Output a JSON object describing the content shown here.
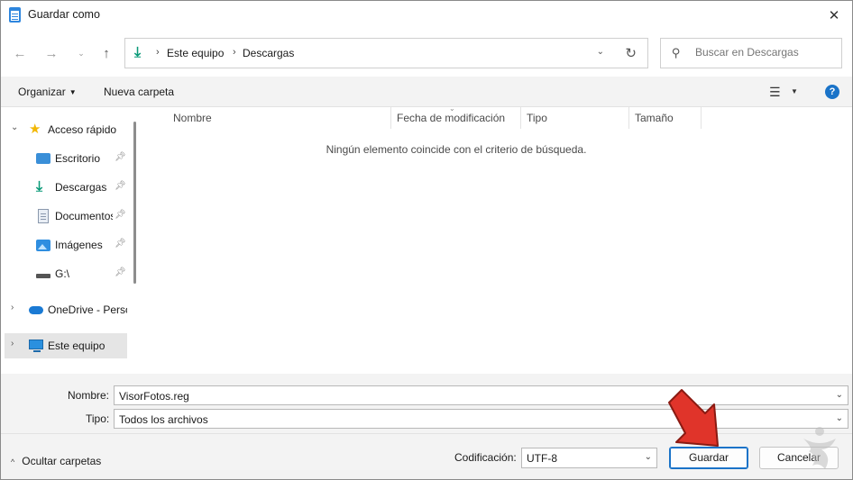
{
  "window": {
    "title": "Guardar como"
  },
  "address": {
    "crumbs": [
      "Este equipo",
      "Descargas"
    ],
    "separator": "›"
  },
  "search": {
    "placeholder": "Buscar en Descargas"
  },
  "toolbar": {
    "organize_label": "Organizar",
    "new_folder_label": "Nueva carpeta",
    "help_label": "?"
  },
  "navpane": {
    "items": [
      {
        "label": "Acceso rápido",
        "icon": "star-icon"
      },
      {
        "label": "Escritorio",
        "icon": "desktop-icon",
        "pinned": true
      },
      {
        "label": "Descargas",
        "icon": "download-icon",
        "pinned": true
      },
      {
        "label": "Documentos",
        "icon": "document-icon",
        "pinned": true
      },
      {
        "label": "Imágenes",
        "icon": "pictures-icon",
        "pinned": true
      },
      {
        "label": "G:\\",
        "icon": "drive-icon",
        "pinned": true
      },
      {
        "label": "OneDrive - Personal",
        "icon": "onedrive-icon"
      },
      {
        "label": "Este equipo",
        "icon": "computer-icon",
        "selected": true
      }
    ]
  },
  "content": {
    "columns": [
      "Nombre",
      "Fecha de modificación",
      "Tipo",
      "Tamaño"
    ],
    "empty_message": "Ningún elemento coincide con el criterio de búsqueda."
  },
  "form": {
    "name_label": "Nombre:",
    "name_value": "VisorFotos.reg",
    "type_label": "Tipo:",
    "type_value": "Todos los archivos"
  },
  "footer": {
    "hide_folders_label": "Ocultar carpetas",
    "encoding_label": "Codificación:",
    "encoding_value": "UTF-8",
    "save_label": "Guardar",
    "cancel_label": "Cancelar"
  },
  "colors": {
    "accent": "#1a73c8",
    "download_green": "#0a9a78",
    "arrow_red": "#e0342a"
  }
}
